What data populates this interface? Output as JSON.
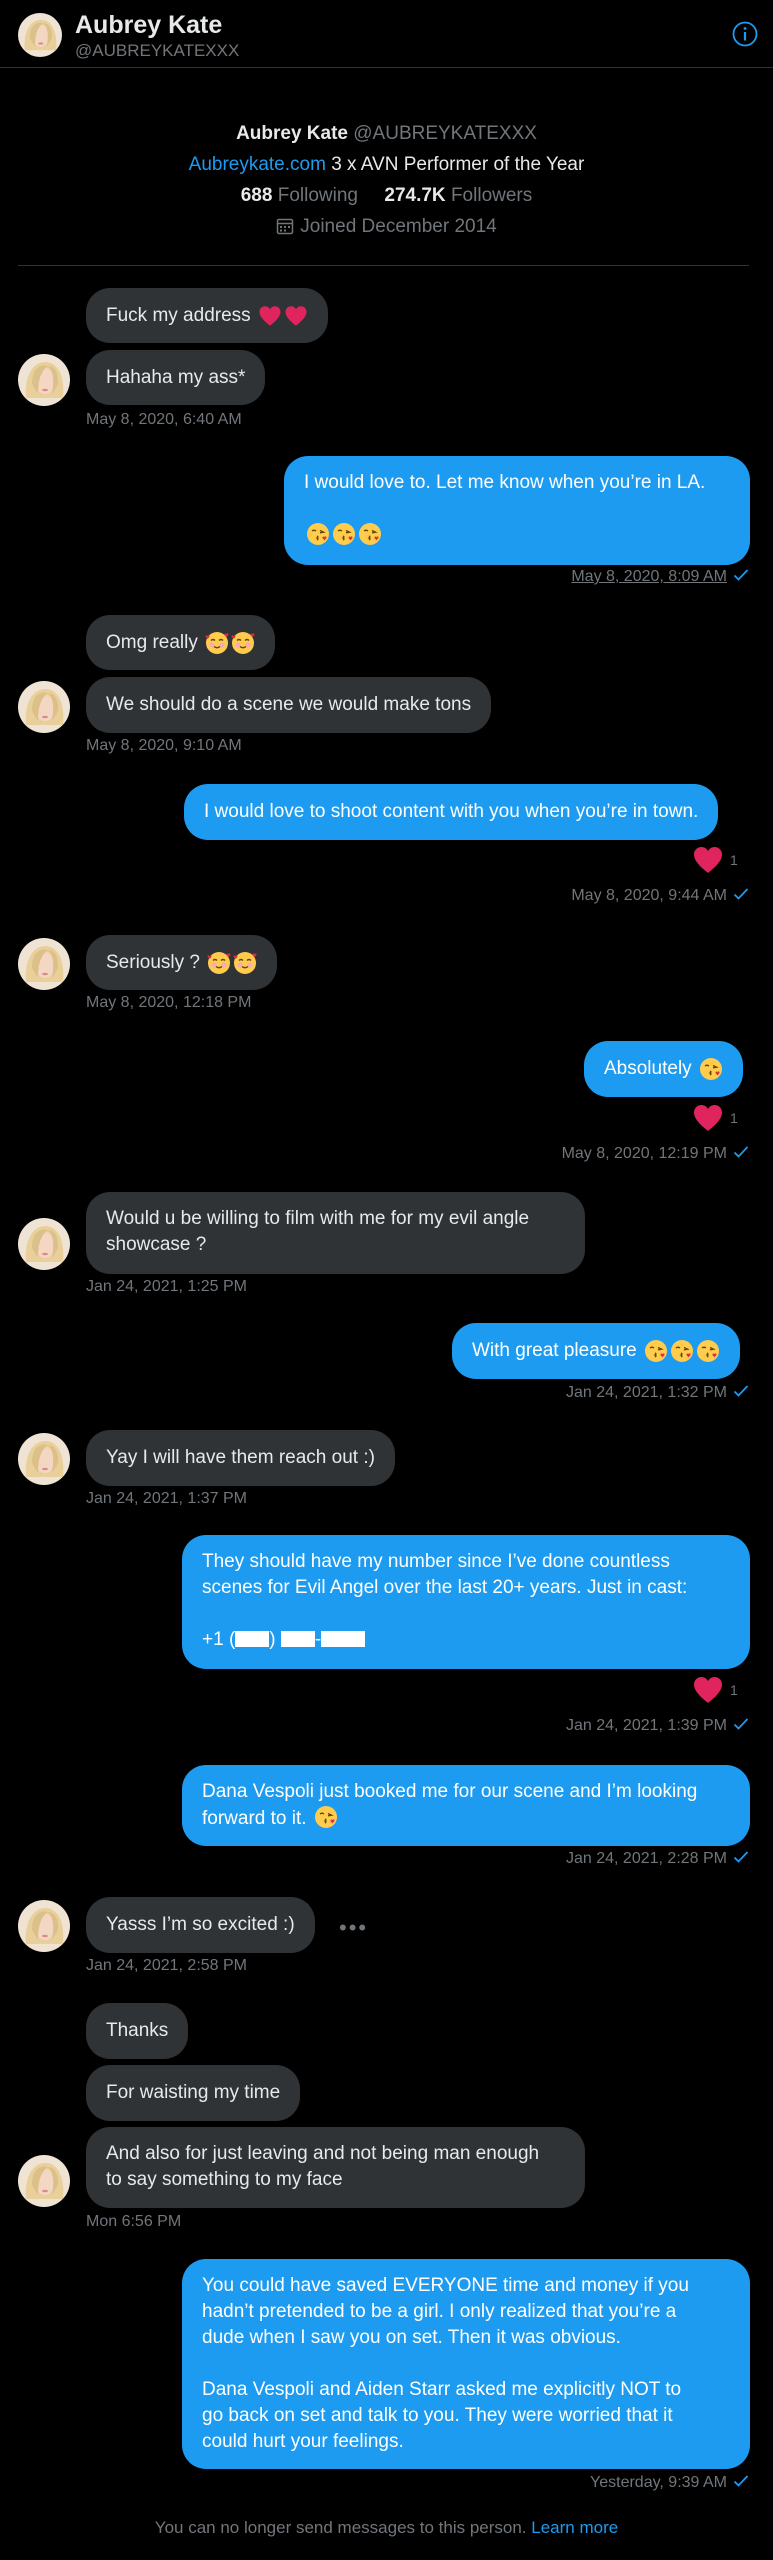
{
  "header": {
    "name": "Aubrey Kate",
    "handle": "@AUBREYKATEXXX",
    "info_icon": "info-icon"
  },
  "profile": {
    "name": "Aubrey Kate",
    "handle": "@AUBREYKATEXXX",
    "website": "Aubreykate.com",
    "bio_rest": " 3 x AVN Performer of the Year",
    "following_count": "688",
    "following_label": " Following",
    "followers_count": "274.7K",
    "followers_label": " Followers",
    "joined": "Joined December 2014"
  },
  "messages": {
    "m1": "Fuck my address",
    "m2": "Hahaha my ass*",
    "t1": "May 8, 2020, 6:40 AM",
    "m3_line1": "I would love to. Let me know when you’re in LA.",
    "t2": "May 8, 2020, 8:09 AM",
    "m4": "Omg really",
    "m5": "We should do a scene we would make tons",
    "t3": "May 8, 2020, 9:10 AM",
    "m6": "I would love to shoot content with you when you’re in town.",
    "r6": "1",
    "t4": "May 8, 2020, 9:44 AM",
    "m7": "Seriously ?",
    "t5": "May 8, 2020, 12:18 PM",
    "m8": "Absolutely",
    "r8": "1",
    "t6": "May 8, 2020, 12:19 PM",
    "m9_line1": "Would u be willing to film with me for my evil angle",
    "m9_line2": "showcase ?",
    "t7": "Jan 24, 2021, 1:25 PM",
    "m10": "With great pleasure",
    "t8": "Jan 24, 2021, 1:32 PM",
    "m11": "Yay I will have them reach out :)",
    "t9": "Jan 24, 2021, 1:37 PM",
    "m12_line1": "They should have my number since I’ve done countless",
    "m12_line2": "scenes for Evil Angel over the last 20+ years. Just in cast:",
    "m12_phone_prefix": "+1 (",
    "r12": "1",
    "t10": "Jan 24, 2021, 1:39 PM",
    "m13_line1": "Dana Vespoli just booked me for our scene and I’m looking",
    "m13_line2": "forward to it.",
    "t11": "Jan 24, 2021, 2:28 PM",
    "m14": "Yasss I’m so excited :)",
    "t12": "Jan 24, 2021, 2:58 PM",
    "m15": "Thanks",
    "m16": "For waisting my time",
    "m17_line1": "And also for just leaving and not being man enough",
    "m17_line2": "to say something to my face",
    "t13": "Mon 6:56 PM",
    "m18_line1": "You could have saved EVERYONE time and money if you",
    "m18_line2": "hadn’t pretended to be a girl. I only realized that you’re a",
    "m18_line3": "dude when I saw you on set. Then it was obvious.",
    "m18_line4": "Dana Vespoli and Aiden Starr asked me explicitly NOT to",
    "m18_line5": "go back on set and talk to you. They were worried that it",
    "m18_line6": "could hurt your feelings.",
    "t14": "Yesterday, 9:39 AM"
  },
  "footer": {
    "text": "You can no longer send messages to this person. ",
    "link": "Learn more"
  },
  "colors": {
    "accent": "#1d9bf0",
    "incoming_bubble": "#2f3336",
    "heart": "#f91880",
    "background": "#000000"
  }
}
